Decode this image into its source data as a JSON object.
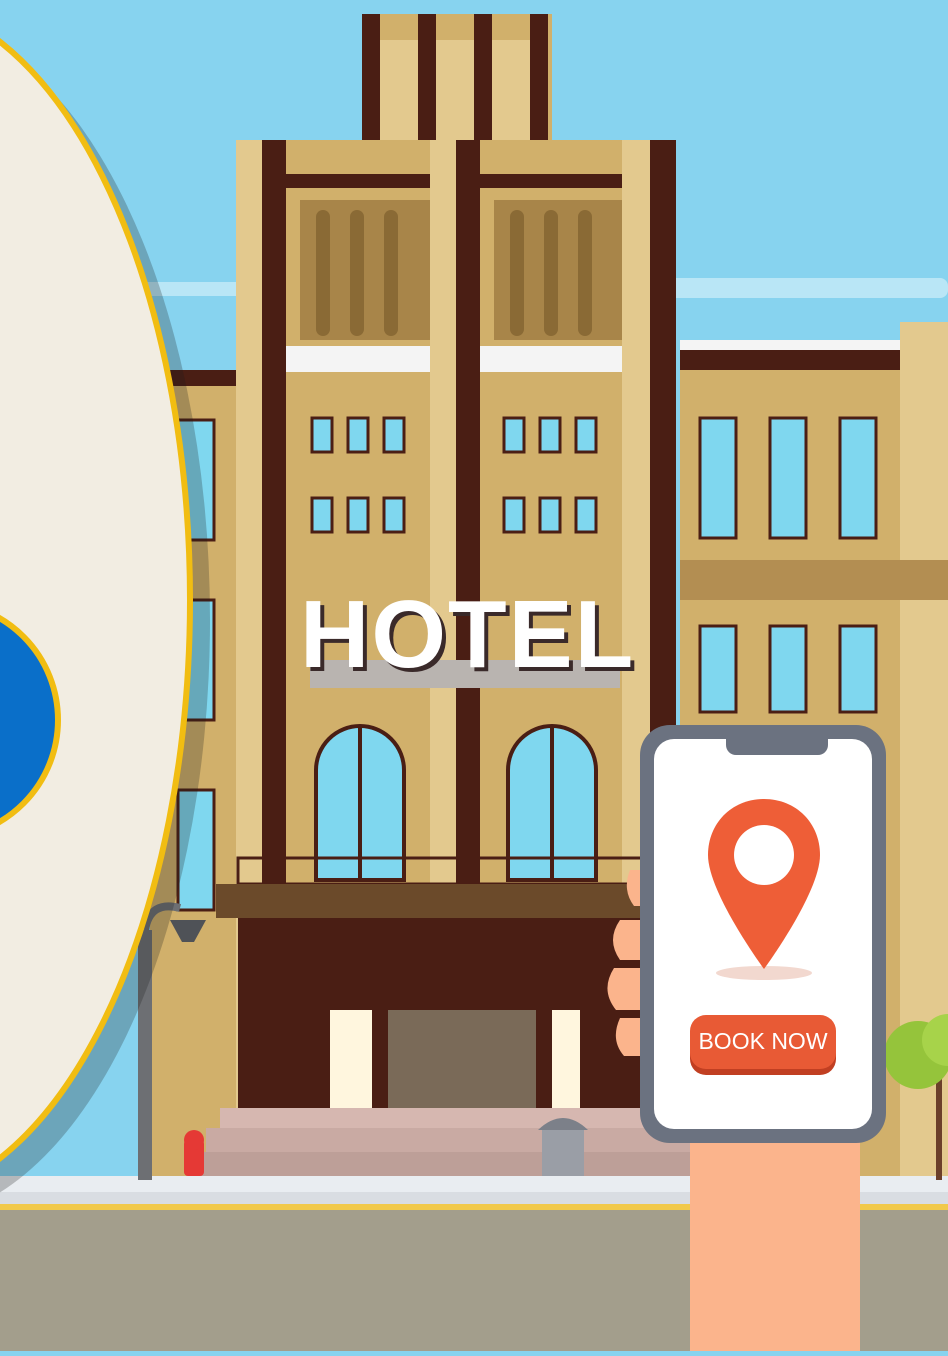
{
  "hotel_sign": {
    "text": "HOTEL"
  },
  "phone": {
    "book_button_label": "BOOK NOW",
    "pin_icon": "location-pin-icon",
    "colors": {
      "button": "#e85a35",
      "pin": "#ee5e37",
      "frame": "#6b7280"
    }
  },
  "palette": {
    "sky": "#87d3ef",
    "building": "#d1b06b",
    "building_dark": "#4a1e14",
    "disc": "#f2ede2",
    "disc_border": "#f1bd12",
    "blue_circle": "#0a6fc9",
    "road": "#a39e8c"
  }
}
